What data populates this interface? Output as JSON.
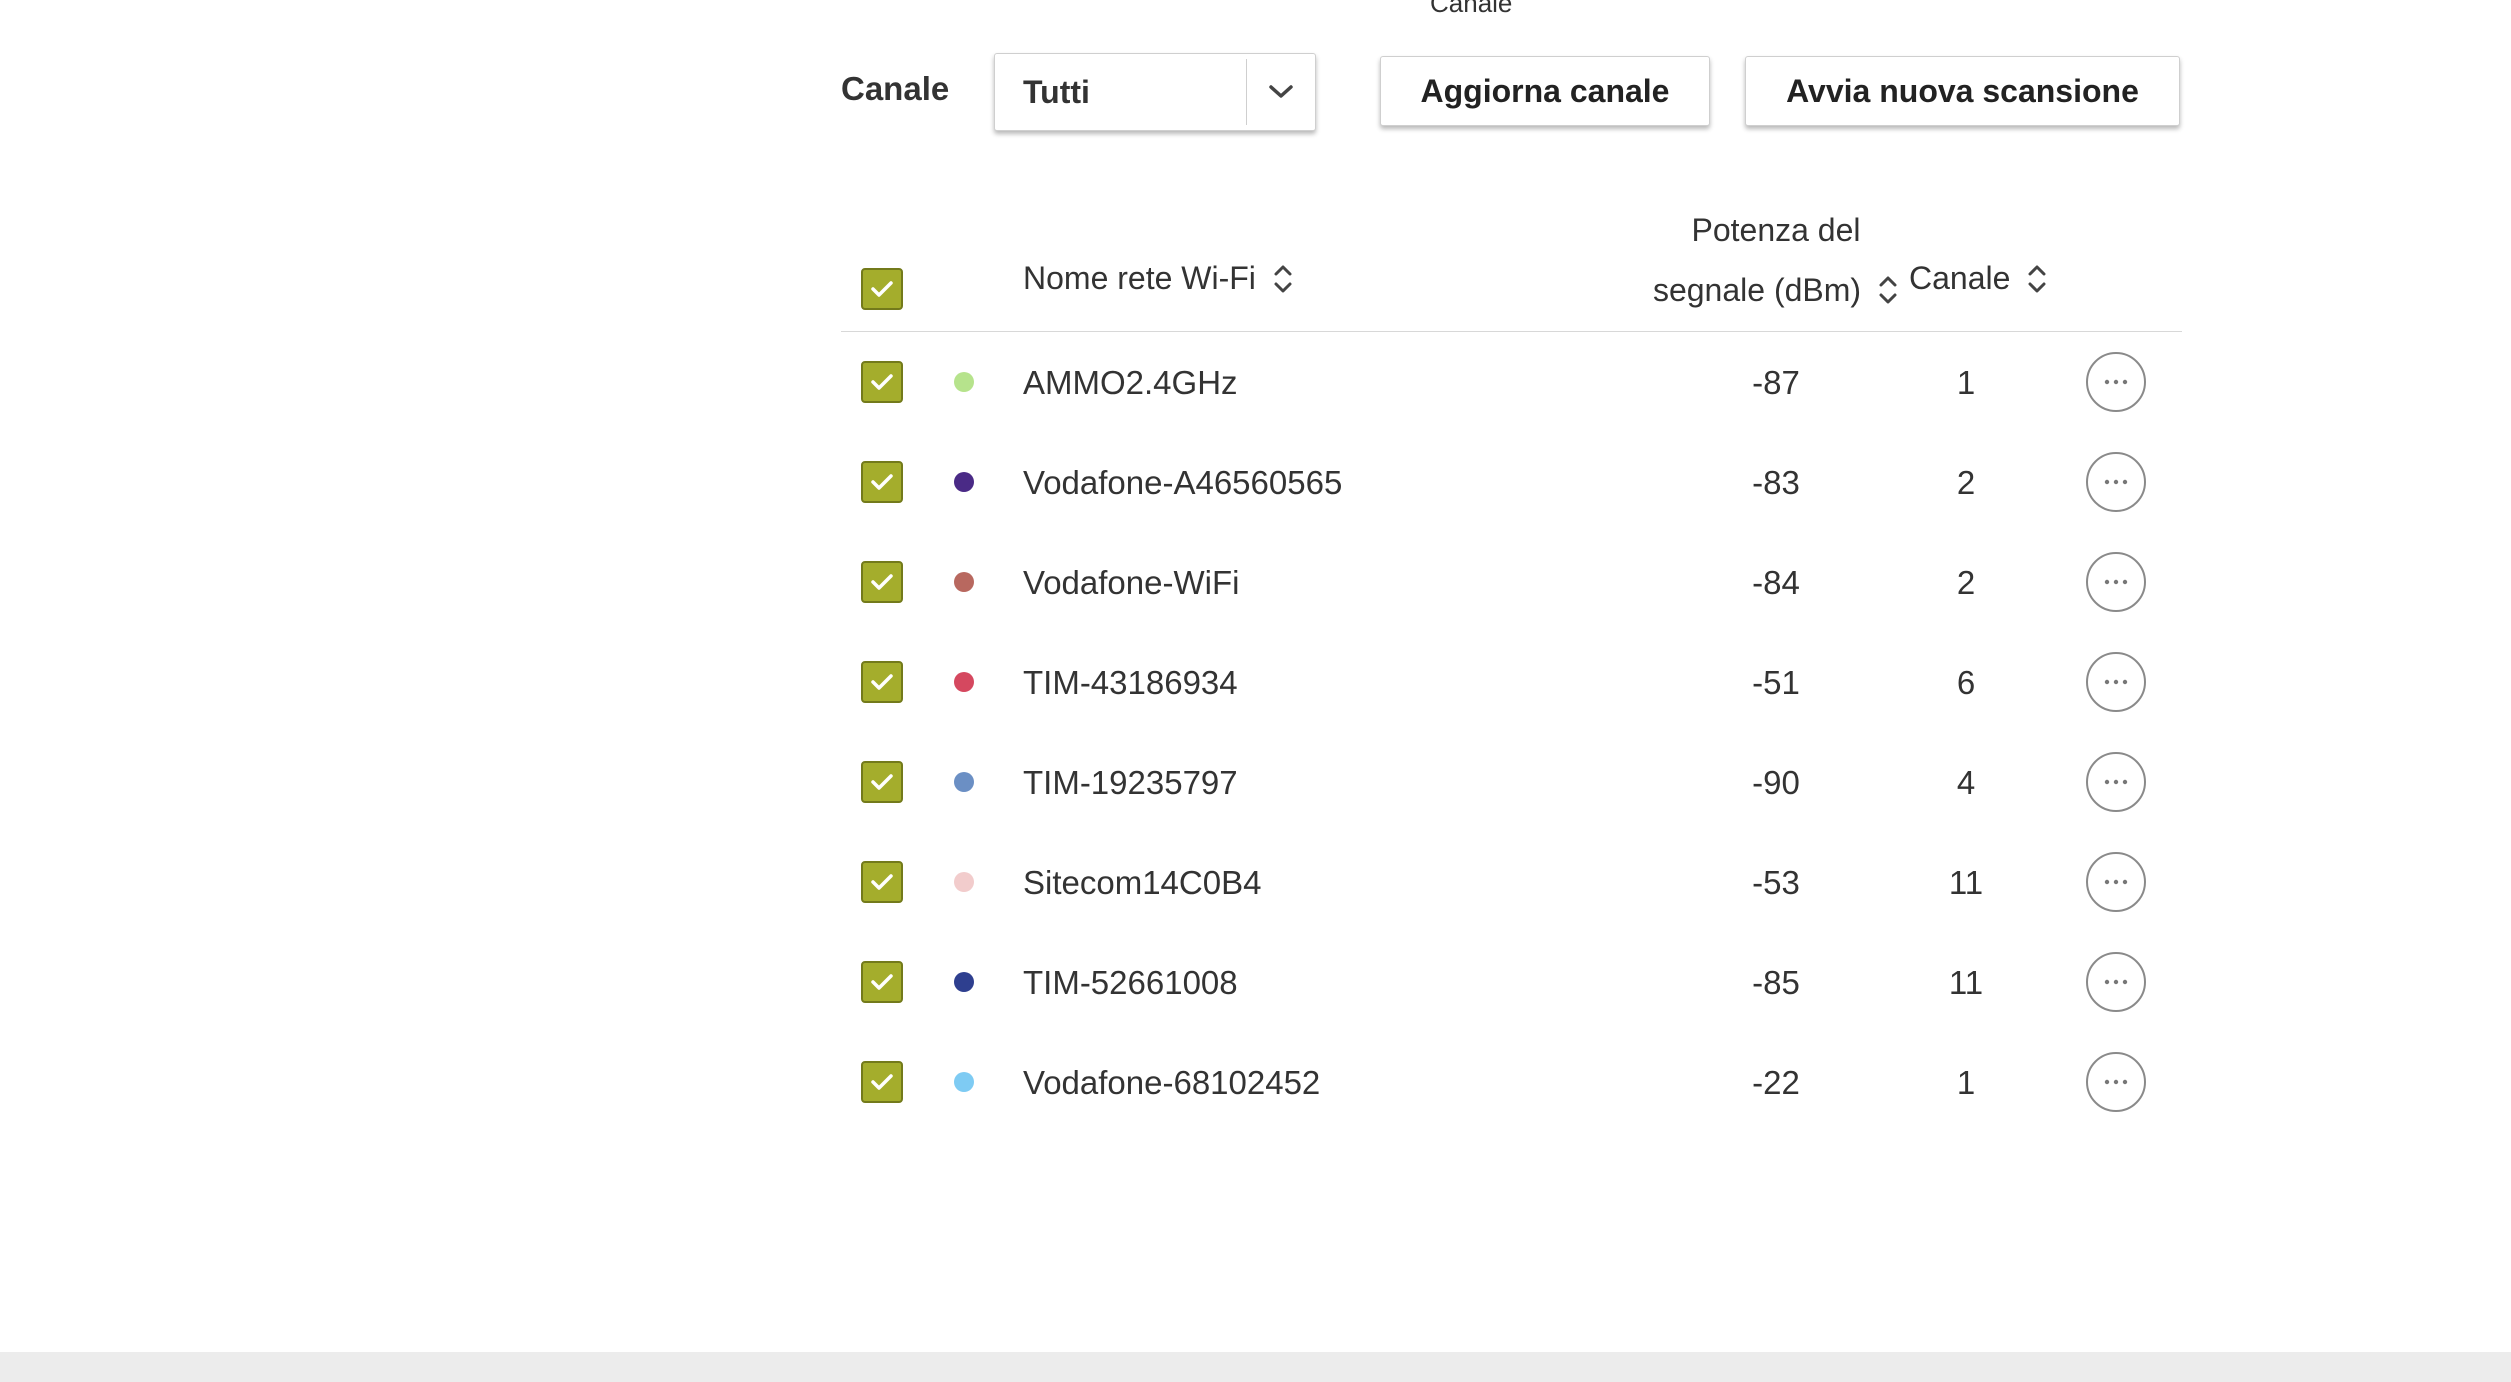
{
  "top_caption": "Canale",
  "toolbar": {
    "channel_label": "Canale",
    "channel_select_value": "Tutti",
    "update_button": "Aggiorna canale",
    "scan_button": "Avvia nuova scansione"
  },
  "table": {
    "headers": {
      "name": "Nome rete Wi-Fi",
      "signal_line1": "Potenza del",
      "signal_line2": "segnale (dBm)",
      "channel": "Canale"
    },
    "rows": [
      {
        "name": "AMMO2.4GHz",
        "signal": "-87",
        "channel": "1",
        "color": "#b6e38c",
        "checked": true
      },
      {
        "name": "Vodafone-A46560565",
        "signal": "-83",
        "channel": "2",
        "color": "#4a2a86",
        "checked": true
      },
      {
        "name": "Vodafone-WiFi",
        "signal": "-84",
        "channel": "2",
        "color": "#b8685f",
        "checked": true
      },
      {
        "name": "TIM-43186934",
        "signal": "-51",
        "channel": "6",
        "color": "#d5485f",
        "checked": true
      },
      {
        "name": "TIM-19235797",
        "signal": "-90",
        "channel": "4",
        "color": "#6b8fc4",
        "checked": true
      },
      {
        "name": "Sitecom14C0B4",
        "signal": "-53",
        "channel": "11",
        "color": "#f2cccc",
        "checked": true
      },
      {
        "name": "TIM-52661008",
        "signal": "-85",
        "channel": "11",
        "color": "#2e3f8f",
        "checked": true
      },
      {
        "name": "Vodafone-68102452",
        "signal": "-22",
        "channel": "1",
        "color": "#7ecbf3",
        "checked": true
      }
    ]
  },
  "colors": {
    "checkbox_fill": "#a4ad2c",
    "checkbox_border": "#737a1b"
  }
}
